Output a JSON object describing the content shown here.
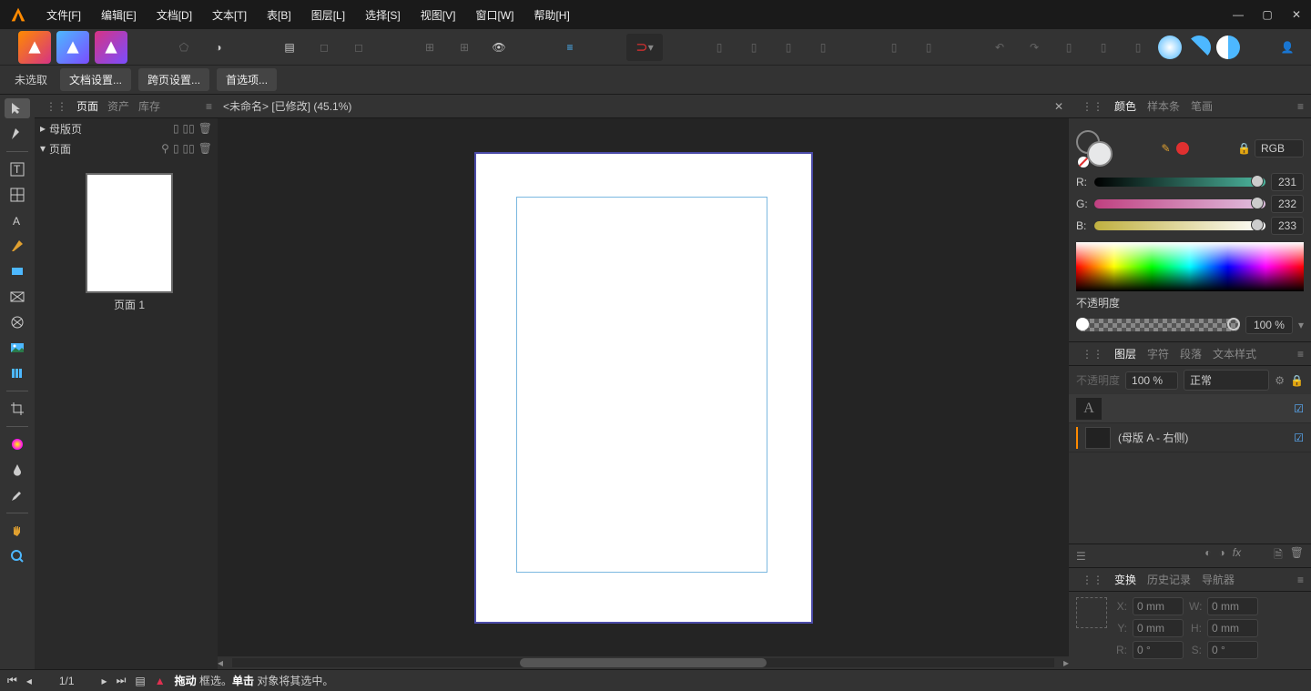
{
  "menu": [
    "文件[F]",
    "编辑[E]",
    "文档[D]",
    "文本[T]",
    "表[B]",
    "图层[L]",
    "选择[S]",
    "视图[V]",
    "窗口[W]",
    "帮助[H]"
  ],
  "context": {
    "status": "未选取",
    "doc_settings": "文档设置...",
    "spread_settings": "跨页设置...",
    "preferences": "首选项..."
  },
  "left_panel": {
    "tabs": [
      "页面",
      "资产",
      "库存"
    ],
    "master_pages": "母版页",
    "pages": "页面",
    "page1_label": "页面 1"
  },
  "doc_tab": "<未命名> [已修改] (45.1%)",
  "color_panel": {
    "tabs": [
      "颜色",
      "样本条",
      "笔画"
    ],
    "mode": "RGB",
    "r_label": "R:",
    "r_value": "231",
    "g_label": "G:",
    "g_value": "232",
    "b_label": "B:",
    "b_value": "233",
    "opacity_label": "不透明度",
    "opacity_value": "100 %"
  },
  "layers_panel": {
    "tabs": [
      "图层",
      "字符",
      "段落",
      "文本样式"
    ],
    "opacity_lbl": "不透明度",
    "opacity_val": "100 %",
    "blend": "正常",
    "master_layer": "(母版 A - 右侧)"
  },
  "transform_panel": {
    "tabs": [
      "变换",
      "历史记录",
      "导航器"
    ],
    "x_lbl": "X:",
    "x_val": "0 mm",
    "y_lbl": "Y:",
    "y_val": "0 mm",
    "w_lbl": "W:",
    "w_val": "0 mm",
    "h_lbl": "H:",
    "h_val": "0 mm",
    "r_lbl": "R:",
    "r_val": "0 °",
    "s_lbl": "S:",
    "s_val": "0 °"
  },
  "status": {
    "pages": "1/1",
    "hint_bold1": "拖动",
    "hint_text1": " 框选。",
    "hint_bold2": "单击",
    "hint_text2": " 对象将其选中。"
  }
}
